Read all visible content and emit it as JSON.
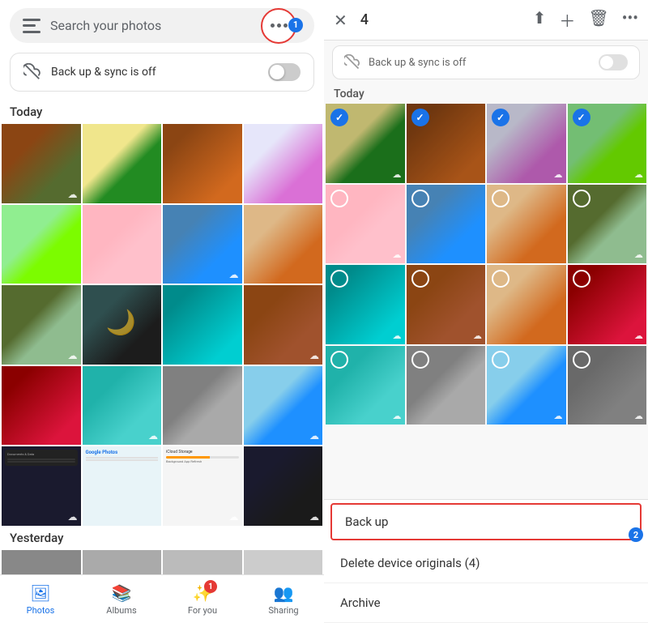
{
  "left": {
    "search": {
      "placeholder": "Search your photos"
    },
    "backup": {
      "label": "Back up & sync is off"
    },
    "today_label": "Today",
    "yesterday_label": "Yesterday",
    "three_dots_badge": "1",
    "photos": [
      {
        "color": "p1",
        "sync": true
      },
      {
        "color": "p2",
        "sync": true
      },
      {
        "color": "p3",
        "sync": true
      },
      {
        "color": "p4",
        "sync": true
      },
      {
        "color": "p5",
        "sync": true
      },
      {
        "color": "p6",
        "sync": true
      },
      {
        "color": "p7",
        "sync": true
      },
      {
        "color": "p8",
        "sync": true
      },
      {
        "color": "p9",
        "sync": false
      },
      {
        "color": "p10",
        "sync": false
      },
      {
        "color": "p11",
        "sync": false
      },
      {
        "color": "p12",
        "sync": false
      },
      {
        "color": "p13",
        "sync": false
      },
      {
        "color": "p14",
        "sync": false
      },
      {
        "color": "p15",
        "sync": false
      },
      {
        "color": "p16",
        "sync": false
      },
      {
        "color": "p17",
        "sync": false
      },
      {
        "color": "p18",
        "sync": false
      },
      {
        "color": "p19",
        "sync": false
      },
      {
        "color": "p20",
        "sync": false
      }
    ],
    "nav": {
      "items": [
        {
          "id": "photos",
          "icon": "🖼",
          "label": "Photos",
          "active": true
        },
        {
          "id": "albums",
          "icon": "📚",
          "label": "Albums",
          "active": false
        },
        {
          "id": "for-you",
          "icon": "✨",
          "label": "For you",
          "active": false,
          "badge": "1"
        },
        {
          "id": "sharing",
          "icon": "👥",
          "label": "Sharing",
          "active": false
        }
      ]
    }
  },
  "right": {
    "header": {
      "count": "4",
      "close": "✕"
    },
    "backup": {
      "label": "Back up & sync is off"
    },
    "today_label": "Today",
    "photos": [
      {
        "color": "p2",
        "selected": true,
        "sync": true
      },
      {
        "color": "p3",
        "selected": true,
        "sync": true
      },
      {
        "color": "p4",
        "selected": true,
        "sync": true
      },
      {
        "color": "p5",
        "selected": true,
        "sync": true
      },
      {
        "color": "p6",
        "selected": false,
        "sync": true
      },
      {
        "color": "p7",
        "selected": false,
        "sync": true
      },
      {
        "color": "p8",
        "selected": false,
        "sync": true
      },
      {
        "color": "p9",
        "selected": false,
        "sync": false
      },
      {
        "color": "p11",
        "selected": false,
        "sync": false
      },
      {
        "color": "p12",
        "selected": false,
        "sync": false
      },
      {
        "color": "p8",
        "selected": false,
        "sync": false
      },
      {
        "color": "p13",
        "selected": false,
        "sync": false
      },
      {
        "color": "p14",
        "selected": false,
        "sync": false
      },
      {
        "color": "p15",
        "selected": false,
        "sync": false
      },
      {
        "color": "p16",
        "selected": false,
        "sync": false
      },
      {
        "color": "p20",
        "selected": false,
        "sync": false
      }
    ],
    "actions": {
      "backup": "Back up",
      "delete": "Delete device originals (4)",
      "archive": "Archive",
      "badge": "2"
    }
  }
}
